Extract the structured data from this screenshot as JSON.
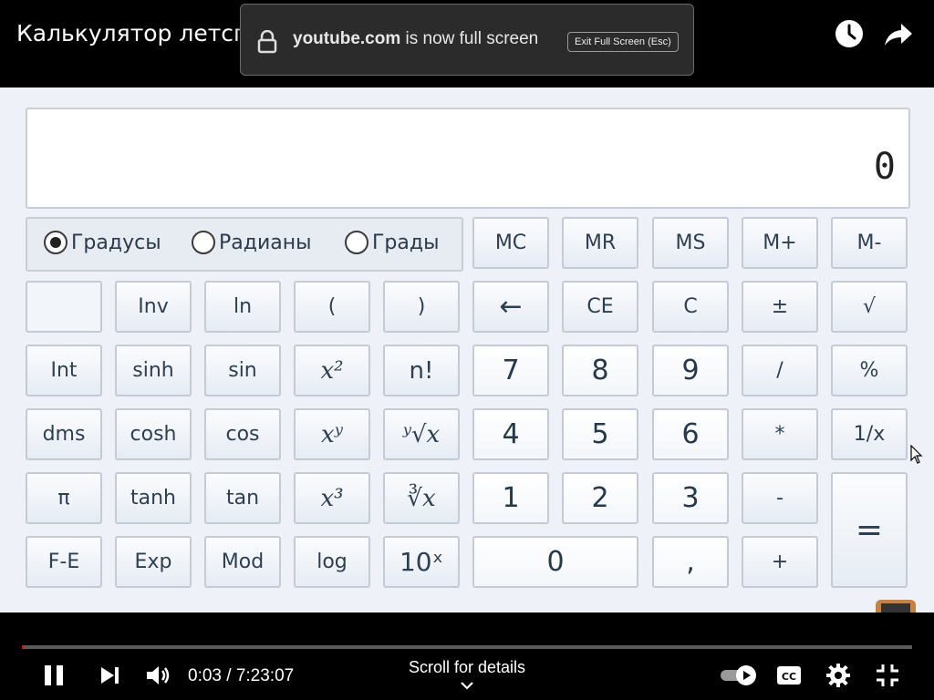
{
  "video": {
    "title": "Калькулятор летсплей",
    "time_current": "0:03",
    "time_total": "7:23:07",
    "progress": 0.0001,
    "scroll_details": "Scroll for details"
  },
  "fullscreen_notice": {
    "domain": "youtube.com",
    "message": " is now full screen",
    "exit_label": "Exit Full Screen (Esc)"
  },
  "calculator": {
    "display_value": "0",
    "angle_modes": [
      {
        "label": "Градусы",
        "selected": true
      },
      {
        "label": "Радианы",
        "selected": false
      },
      {
        "label": "Грады",
        "selected": false
      }
    ],
    "memory_row": [
      "MC",
      "MR",
      "MS",
      "M+",
      "M-"
    ],
    "row2": [
      "",
      "Inv",
      "ln",
      "(",
      ")",
      "←",
      "CE",
      "C",
      "±",
      "√"
    ],
    "row3": [
      "Int",
      "sinh",
      "sin",
      "x²",
      "n!",
      "7",
      "8",
      "9",
      "/",
      "%"
    ],
    "row4": [
      "dms",
      "cosh",
      "cos",
      "xʸ",
      "ʸ√x",
      "4",
      "5",
      "6",
      "*",
      "1/x"
    ],
    "row5": [
      "π",
      "tanh",
      "tan",
      "x³",
      "∛x",
      "1",
      "2",
      "3",
      "-",
      "="
    ],
    "row6": [
      "F-E",
      "Exp",
      "Mod",
      "log",
      "10ˣ",
      "0",
      ",",
      "+"
    ]
  },
  "icons": {
    "watch_later": "clock-icon",
    "share": "share-icon",
    "lock": "lock-icon",
    "pause": "pause-icon",
    "next": "next-icon",
    "volume": "volume-icon",
    "autoplay": "autoplay-toggle-icon",
    "captions": "captions-icon",
    "settings": "gear-icon",
    "exit_fullscreen": "exit-fullscreen-icon"
  }
}
